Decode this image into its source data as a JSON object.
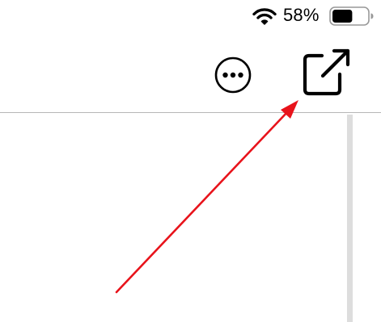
{
  "status_bar": {
    "wifi_icon": "wifi-icon",
    "battery_percent": "58%",
    "battery_icon": "battery-icon",
    "battery_level": 0.58
  },
  "toolbar": {
    "more_icon": "ellipsis-circle-icon",
    "share_icon": "open-in-new-window-icon"
  },
  "annotation": {
    "type": "arrow",
    "color": "#e8131b",
    "points_to": "share-button"
  }
}
